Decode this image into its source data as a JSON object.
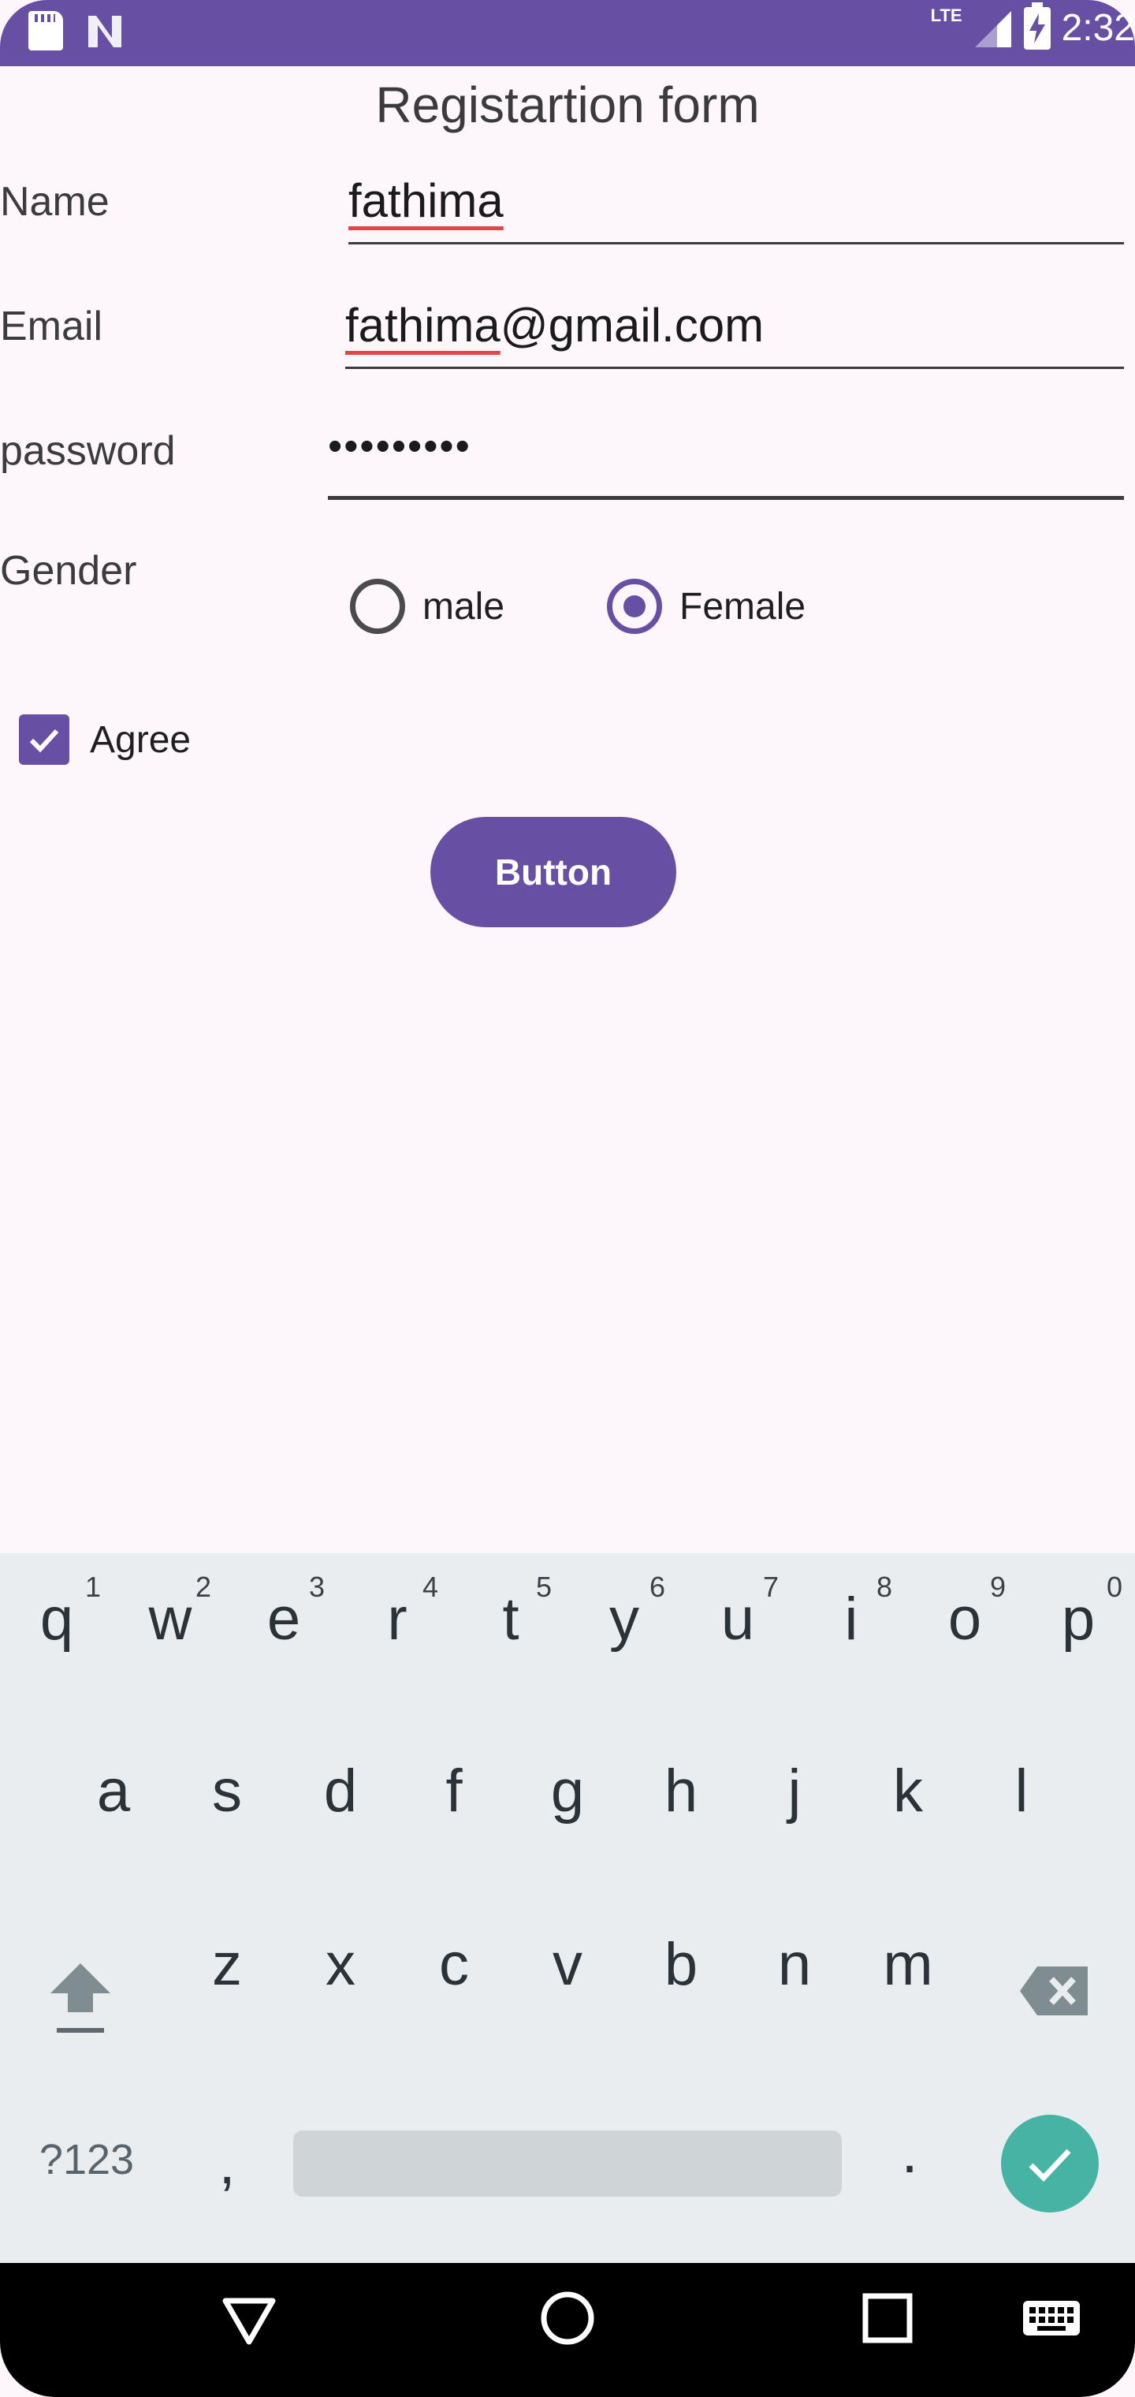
{
  "status_bar": {
    "time": "2:32",
    "network": "LTE"
  },
  "form": {
    "title": "Registartion form",
    "name_label": "Name",
    "name_value": "fathima",
    "email_label": "Email",
    "email_value_spell": "fathima",
    "email_value_rest": "@gmail.com",
    "password_label": "password",
    "password_value": "•••••••••",
    "gender_label": "Gender",
    "gender_options": [
      "male",
      "Female"
    ],
    "gender_selected": "Female",
    "agree_label": "Agree",
    "agree_checked": true,
    "button_label": "Button"
  },
  "keyboard": {
    "row1": [
      {
        "key": "q",
        "hint": "1"
      },
      {
        "key": "w",
        "hint": "2"
      },
      {
        "key": "e",
        "hint": "3"
      },
      {
        "key": "r",
        "hint": "4"
      },
      {
        "key": "t",
        "hint": "5"
      },
      {
        "key": "y",
        "hint": "6"
      },
      {
        "key": "u",
        "hint": "7"
      },
      {
        "key": "i",
        "hint": "8"
      },
      {
        "key": "o",
        "hint": "9"
      },
      {
        "key": "p",
        "hint": "0"
      }
    ],
    "row2": [
      "a",
      "s",
      "d",
      "f",
      "g",
      "h",
      "j",
      "k",
      "l"
    ],
    "row3": [
      "z",
      "x",
      "c",
      "v",
      "b",
      "n",
      "m"
    ],
    "symbols_label": "?123",
    "comma": ",",
    "period": "."
  },
  "colors": {
    "accent": "#6750a4",
    "background": "#fdf6fb",
    "keyboard_bg": "#e9edf0",
    "enter": "#46b3a4"
  }
}
